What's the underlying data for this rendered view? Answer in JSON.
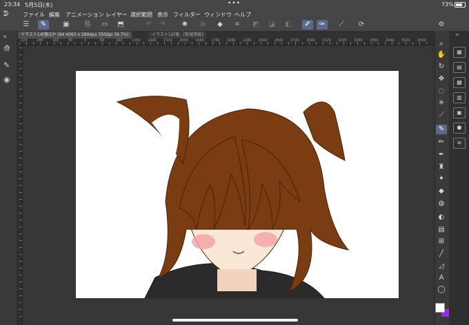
{
  "status": {
    "time": "23:34",
    "date": "5月5日(木)",
    "battery": "73%",
    "dots": "•••"
  },
  "menu": [
    "ファイル",
    "編集",
    "アニメーション",
    "レイヤー",
    "選択範囲",
    "表示",
    "フィルター",
    "ウィンドウ",
    "ヘルプ"
  ],
  "tabs": [
    {
      "label": "イラスト14[復元]* (A4 4093 x 2894px 350dpi 39.7%)",
      "active": true
    },
    {
      "label": "イラスト12(復...",
      "active": false
    },
    {
      "label": "[新規用紙]",
      "active": false
    }
  ],
  "ruler_labels": [
    "320",
    "280",
    "160",
    "80",
    "0",
    "80",
    "160",
    "1360",
    "1440",
    "1520",
    "1600",
    "1680",
    "1760",
    "1840",
    "2280",
    "2560",
    "2640",
    "2720",
    "3040",
    "3120",
    "3200",
    "3280",
    "3360",
    "3440",
    "3520",
    "3600"
  ],
  "colors": {
    "main": "#ffffff",
    "sub": "#9b2bd6",
    "accent": "#5a6a8a"
  }
}
